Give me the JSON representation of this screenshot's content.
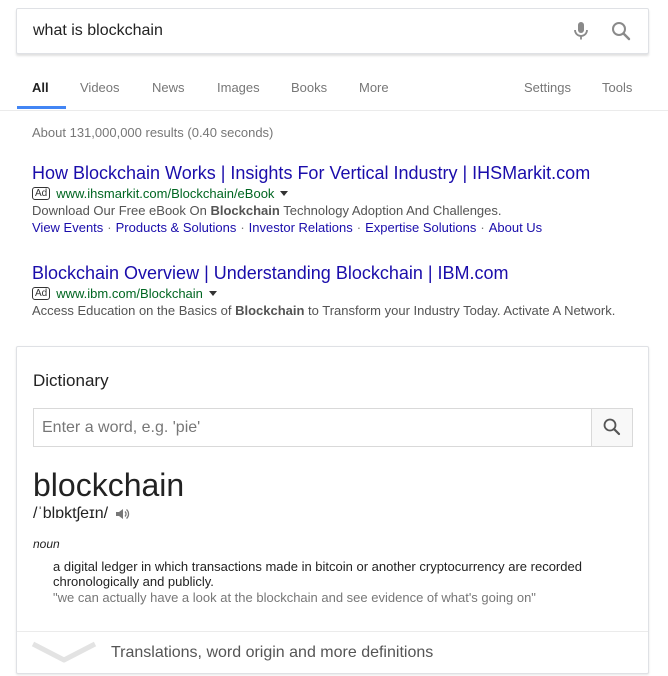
{
  "search": {
    "query": "what is blockchain",
    "mic_icon": "microphone-icon",
    "search_icon": "magnifier-icon"
  },
  "tabs": [
    {
      "label": "All",
      "active": true
    },
    {
      "label": "Videos"
    },
    {
      "label": "News"
    },
    {
      "label": "Images"
    },
    {
      "label": "Books"
    },
    {
      "label": "More"
    },
    {
      "label": "Settings"
    },
    {
      "label": "Tools"
    }
  ],
  "results_count": "About 131,000,000 results (0.40 seconds)",
  "ads": [
    {
      "title": "How Blockchain Works | Insights For Vertical Industry | IHSMarkit.com",
      "badge": "Ad",
      "url": "www.ihsmarkit.com/Blockchain/eBook",
      "desc_before": "Download Our Free eBook On ",
      "desc_bold": "Blockchain",
      "desc_after": " Technology Adoption And Challenges.",
      "sitelinks": [
        "View Events",
        "Products & Solutions",
        "Investor Relations",
        "Expertise Solutions",
        "About Us"
      ]
    },
    {
      "title": "Blockchain Overview | Understanding Blockchain | IBM.com",
      "badge": "Ad",
      "url": "www.ibm.com/Blockchain",
      "desc_before": "Access Education on the Basics of ",
      "desc_bold": "Blockchain",
      "desc_after": " to Transform your Industry Today. Activate A Network."
    }
  ],
  "dictionary": {
    "heading": "Dictionary",
    "input_placeholder": "Enter a word, e.g. 'pie'",
    "word": "blockchain",
    "pronunciation": "/ˈblɒktʃeɪn/",
    "part_of_speech": "noun",
    "definition": "a digital ledger in which transactions made in bitcoin or another cryptocurrency are recorded chronologically and publicly.",
    "example": "\"we can actually have a look at the blockchain and see evidence of what's going on\"",
    "more_label": "Translations, word origin and more definitions"
  },
  "colors": {
    "link": "#1a0dab",
    "url_green": "#006621",
    "tab_active": "#4285f4"
  }
}
